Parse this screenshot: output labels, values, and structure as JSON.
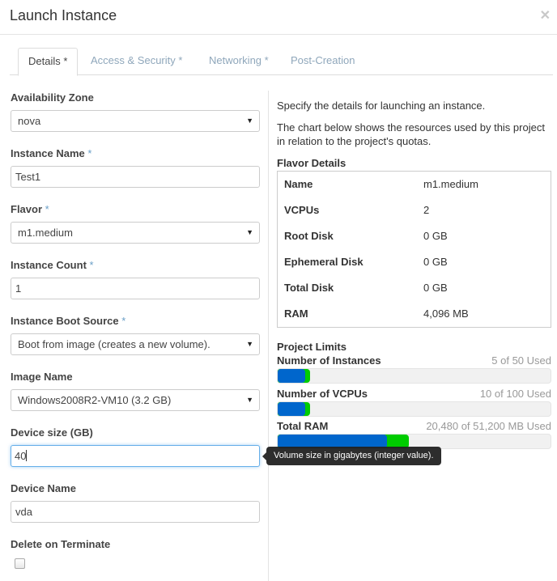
{
  "dialog": {
    "title": "Launch Instance",
    "close_icon": "close-icon"
  },
  "tabs": [
    {
      "label": "Details",
      "required": "*",
      "active": true
    },
    {
      "label": "Access & Security",
      "required": "*",
      "active": false
    },
    {
      "label": "Networking",
      "required": "*",
      "active": false
    },
    {
      "label": "Post-Creation",
      "required": "",
      "active": false
    }
  ],
  "form": {
    "availability_zone": {
      "label": "Availability Zone",
      "value": "nova"
    },
    "instance_name": {
      "label": "Instance Name",
      "required": "*",
      "value": "Test1"
    },
    "flavor": {
      "label": "Flavor",
      "required": "*",
      "value": "m1.medium"
    },
    "instance_count": {
      "label": "Instance Count",
      "required": "*",
      "value": "1"
    },
    "boot_source": {
      "label": "Instance Boot Source",
      "required": "*",
      "value": "Boot from image (creates a new volume)."
    },
    "image_name": {
      "label": "Image Name",
      "value": "Windows2008R2-VM10 (3.2 GB)"
    },
    "device_size": {
      "label": "Device size (GB)",
      "value": "40",
      "tooltip": "Volume size in gigabytes (integer value)."
    },
    "device_name": {
      "label": "Device Name",
      "value": "vda"
    },
    "delete_on_terminate": {
      "label": "Delete on Terminate",
      "checked": false
    }
  },
  "info": {
    "line1": "Specify the details for launching an instance.",
    "line2": "The chart below shows the resources used by this project in relation to the project's quotas."
  },
  "flavor_details": {
    "title": "Flavor Details",
    "rows": [
      {
        "key": "Name",
        "value": "m1.medium"
      },
      {
        "key": "VCPUs",
        "value": "2"
      },
      {
        "key": "Root Disk",
        "value": "0 GB"
      },
      {
        "key": "Ephemeral Disk",
        "value": "0 GB"
      },
      {
        "key": "Total Disk",
        "value": "0 GB"
      },
      {
        "key": "RAM",
        "value": "4,096 MB"
      }
    ]
  },
  "project_limits": {
    "title": "Project Limits",
    "colors": {
      "used": "#0066cc",
      "added": "#00cc00",
      "track": "#f1f1f1"
    },
    "items": [
      {
        "label": "Number of Instances",
        "used_text": "5 of 50 Used",
        "used": 5,
        "added": 1,
        "quota": 50
      },
      {
        "label": "Number of VCPUs",
        "used_text": "10 of 100 Used",
        "used": 10,
        "added": 2,
        "quota": 100
      },
      {
        "label": "Total RAM",
        "used_text": "20,480 of 51,200 MB Used",
        "used": 20480,
        "added": 4096,
        "quota": 51200
      }
    ]
  }
}
